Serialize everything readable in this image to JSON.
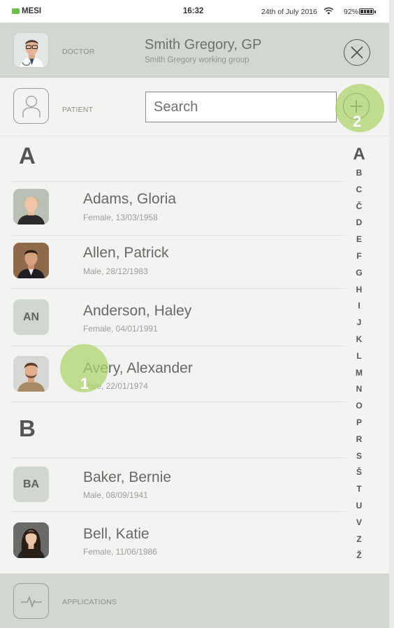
{
  "status_bar": {
    "carrier": "MESI",
    "time": "16:32",
    "date": "24th of July 2016",
    "battery_pct": "92%",
    "icons": [
      "wifi-icon",
      "battery-icon"
    ]
  },
  "doctor": {
    "role": "DOCTOR",
    "name": "Smith Gregory, GP",
    "group": "Smith Gregory working group",
    "close_icon": "close-icon"
  },
  "patient": {
    "role": "PATIENT",
    "search_placeholder": "Search",
    "add_icon": "plus-circle-icon"
  },
  "touch_markers": {
    "first": "1",
    "second": "2"
  },
  "sections": [
    {
      "letter": "A",
      "patients": [
        {
          "name": "Adams, Gloria",
          "info": "Female, 13/03/1958",
          "avatar": "photo"
        },
        {
          "name": "Allen, Patrick",
          "info": "Male, 28/12/1983",
          "avatar": "photo"
        },
        {
          "name": "Anderson, Haley",
          "info": "Female, 04/01/1991",
          "initials": "AN"
        },
        {
          "name": "Avery, Alexander",
          "info": "Male, 22/01/1974",
          "avatar": "photo"
        }
      ]
    },
    {
      "letter": "B",
      "patients": [
        {
          "name": "Baker, Bernie",
          "info": "Male, 08/09/1941",
          "initials": "BA"
        },
        {
          "name": "Bell, Katie",
          "info": "Female, 11/06/1986",
          "avatar": "photo"
        }
      ]
    }
  ],
  "alphabet_index": [
    "A",
    "B",
    "C",
    "Č",
    "D",
    "E",
    "F",
    "G",
    "H",
    "I",
    "J",
    "K",
    "L",
    "M",
    "N",
    "O",
    "P",
    "R",
    "S",
    "Š",
    "T",
    "U",
    "V",
    "Z",
    "Ž"
  ],
  "footer": {
    "label": "APPLICATIONS",
    "icon": "heartbeat-icon"
  },
  "colors": {
    "header_bg": "#d2d8d1",
    "page_bg": "#f3f3f1",
    "tap_marker": "#acd469"
  }
}
